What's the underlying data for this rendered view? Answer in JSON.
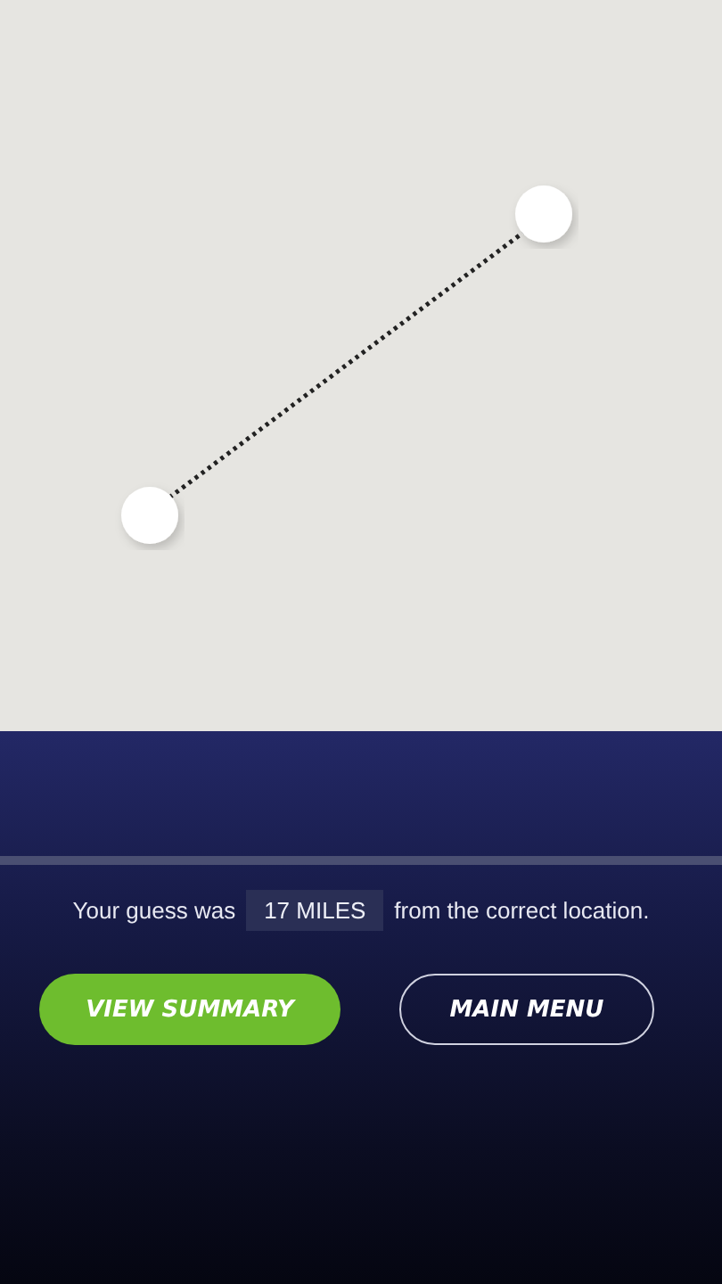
{
  "result": {
    "prefix": "Your guess was",
    "distance": "17 MILES",
    "suffix": "from the correct location."
  },
  "buttons": [
    {
      "label": "VIEW SUMMARY",
      "kind": "primary"
    },
    {
      "label": "MAIN MENU",
      "kind": "outline"
    }
  ]
}
